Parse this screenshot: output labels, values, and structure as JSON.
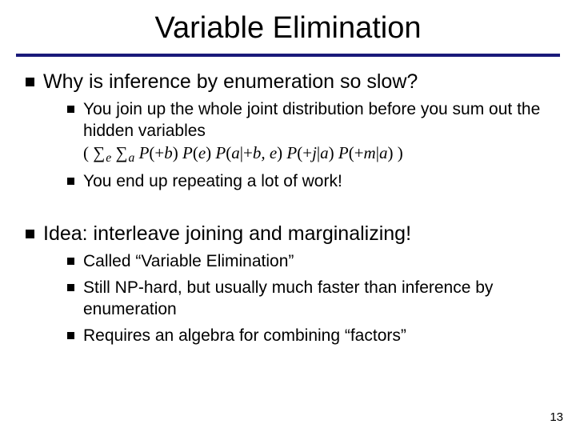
{
  "title": "Variable Elimination",
  "section1": {
    "heading": "Why is inference by enumeration so slow?",
    "bullets": {
      "b1_pre": "You join up the whole joint distribution before you sum out the hidden variables",
      "b1_open": "( ",
      "b1_sum1": "∑",
      "b1_sub1": "e",
      "b1_sp1": " ",
      "b1_sum2": "∑",
      "b1_sub2": "a",
      "b1_sp2": " ",
      "b1_p1a": "P",
      "b1_p1b": "(+",
      "b1_p1c": "b",
      "b1_p1d": ") ",
      "b1_p2a": "P",
      "b1_p2b": "(",
      "b1_p2c": "e",
      "b1_p2d": ") ",
      "b1_p3a": "P",
      "b1_p3b": "(",
      "b1_p3c": "a",
      "b1_p3d": "|+",
      "b1_p3e": "b, e",
      "b1_p3f": ") ",
      "b1_p4a": "P",
      "b1_p4b": "(+",
      "b1_p4c": "j",
      "b1_p4d": "|",
      "b1_p4e": "a",
      "b1_p4f": ") ",
      "b1_p5a": "P",
      "b1_p5b": "(+",
      "b1_p5c": "m",
      "b1_p5d": "|",
      "b1_p5e": "a",
      "b1_p5f": ") ",
      "b1_close": ")",
      "b2": "You end up repeating a lot of work!"
    }
  },
  "section2": {
    "heading": "Idea: interleave joining and marginalizing!",
    "bullets": {
      "b1": "Called “Variable Elimination”",
      "b2": "Still NP-hard, but usually much faster than inference by enumeration",
      "b3": "Requires an algebra for combining “factors”"
    }
  },
  "page_number": "13"
}
